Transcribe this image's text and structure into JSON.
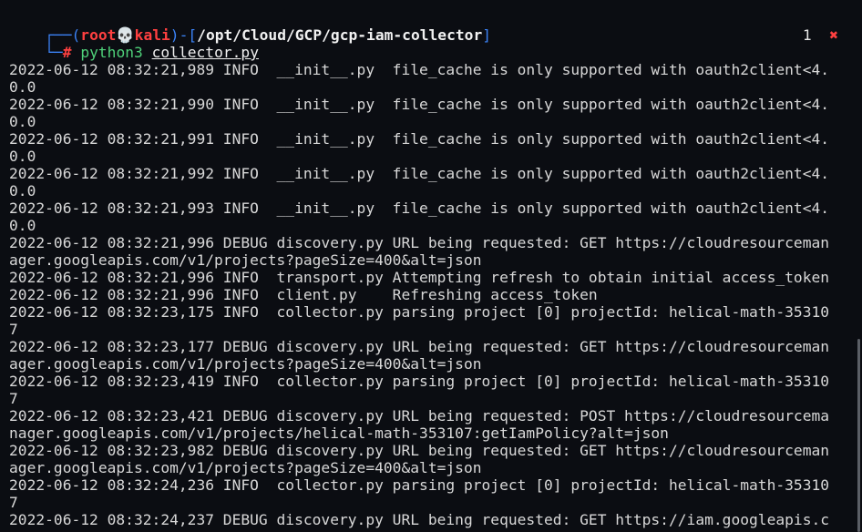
{
  "prompt": {
    "top_prefix": "┌──(",
    "user": "root",
    "skull": "💀",
    "host": "kali",
    "sep": ")-[",
    "path": "/opt/Cloud/GCP/gcp-iam-collector",
    "path_close": "]",
    "bottom_prefix": "└─",
    "hash": "#",
    "command": "python3",
    "argument": "collector.py"
  },
  "job_indicator": {
    "number": "1",
    "mark": "✖"
  },
  "log_lines": [
    "2022-06-12 08:32:21,989 INFO  __init__.py  file_cache is only supported with oauth2client<4.",
    "0.0",
    "2022-06-12 08:32:21,990 INFO  __init__.py  file_cache is only supported with oauth2client<4.",
    "0.0",
    "2022-06-12 08:32:21,991 INFO  __init__.py  file_cache is only supported with oauth2client<4.",
    "0.0",
    "2022-06-12 08:32:21,992 INFO  __init__.py  file_cache is only supported with oauth2client<4.",
    "0.0",
    "2022-06-12 08:32:21,993 INFO  __init__.py  file_cache is only supported with oauth2client<4.",
    "0.0",
    "2022-06-12 08:32:21,996 DEBUG discovery.py URL being requested: GET https://cloudresourceman",
    "ager.googleapis.com/v1/projects?pageSize=400&alt=json",
    "2022-06-12 08:32:21,996 INFO  transport.py Attempting refresh to obtain initial access_token",
    "2022-06-12 08:32:21,996 INFO  client.py    Refreshing access_token",
    "2022-06-12 08:32:23,175 INFO  collector.py parsing project [0] projectId: helical-math-35310",
    "7",
    "2022-06-12 08:32:23,177 DEBUG discovery.py URL being requested: GET https://cloudresourceman",
    "ager.googleapis.com/v1/projects?pageSize=400&alt=json",
    "2022-06-12 08:32:23,419 INFO  collector.py parsing project [0] projectId: helical-math-35310",
    "7",
    "2022-06-12 08:32:23,421 DEBUG discovery.py URL being requested: POST https://cloudresourcema",
    "nager.googleapis.com/v1/projects/helical-math-353107:getIamPolicy?alt=json",
    "2022-06-12 08:32:23,982 DEBUG discovery.py URL being requested: GET https://cloudresourceman",
    "ager.googleapis.com/v1/projects?pageSize=400&alt=json",
    "2022-06-12 08:32:24,236 INFO  collector.py parsing project [0] projectId: helical-math-35310",
    "7",
    "2022-06-12 08:32:24,237 DEBUG discovery.py URL being requested: GET https://iam.googleapis.c"
  ],
  "colors": {
    "background": "#0b0d12",
    "prompt_frame": "#3b82f6",
    "prompt_user": "#ff4040",
    "command": "#4fd27a",
    "text": "#d8d8d8"
  }
}
